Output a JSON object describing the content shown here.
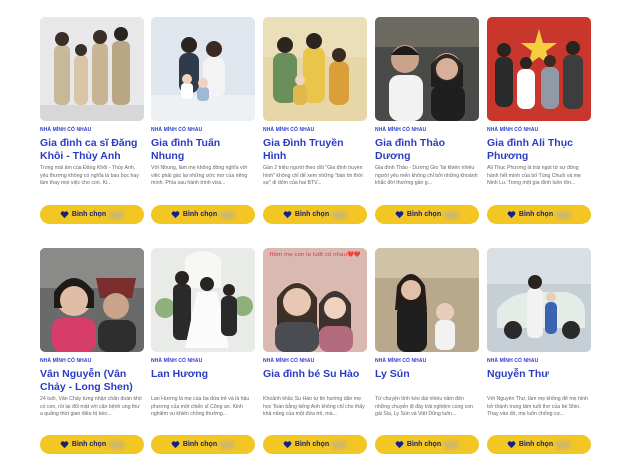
{
  "cards": [
    {
      "tag": "nhà mình có nhau",
      "name": "Gia đình ca sĩ Đăng Khôi - Thủy Anh",
      "desc": "Trong mái ấm của Đăng Khôi - Thủy Anh, yêu thương không có nghĩa là bao bọc hay làm thay mọi việc cho con. Ki...",
      "vote": "Bình chọn",
      "bg": "#e8e8ea"
    },
    {
      "tag": "nhà mình có nhau",
      "name": "Gia đình Tuấn Nhung",
      "desc": "Với Nhung, làm mẹ không đồng nghĩa với việc phải gác lại những ước mơ của riêng mình. Phía sau hành trình vừa...",
      "vote": "Bình chọn",
      "bg": "#dfe6ee"
    },
    {
      "tag": "nhà mình có nhau",
      "name": "Gia Đình Truyền Hình",
      "desc": "Gần 2 triệu người theo dõi \"Gia đình truyền hình\" không chỉ để xem những \"bàn tin thời sự\" di dỏm của hai BTV...",
      "vote": "Bình chọn",
      "bg": "#e7d7a8"
    },
    {
      "tag": "nhà mình có nhau",
      "name": "Gia đình Thảo Dương",
      "desc": "Gia đình Thảo - Dương Gio Tai khiến nhiều người yêu mến không chỉ bởi những khoảnh khắc đời thường gần g...",
      "vote": "Bình chọn",
      "bg": "#4a4a48"
    },
    {
      "tag": "nhà mình có nhau",
      "name": "Gia đình Ali Thục Phương",
      "desc": "Ali Thục Phương là trái ngọt từ sự đồng hành hết mình của bố Tùng Chuối và mẹ Ninh Lu. Trong một gia đình luôn tôn...",
      "vote": "Bình chọn",
      "bg": "#c9372c"
    },
    {
      "tag": "nhà mình có nhau",
      "name": "Vân Nguyễn (Vân Chảy - Long Shen)",
      "desc": "24 tuổi, Vân Chảy từng nhận chẩn đoán khó có con, rồi lại đối mặt với căn bệnh ung thư a quãng thời gian điều trị kéo...",
      "vote": "Bình chọn",
      "bg": "#6a6a6a"
    },
    {
      "tag": "nhà mình có nhau",
      "name": "Lan Hương",
      "desc": "Lan Hương là mẹ của ba đứa trẻ và là hậu phương của một chiến sĩ Công an. Kinh nghiệm vụ khiến chồng thường...",
      "vote": "Bình chọn",
      "bg": "#e9ebe8"
    },
    {
      "tag": "nhà mình có nhau",
      "name": "Gia đình bé Su Hào",
      "desc": "Khoảnh khắc Su Hào tự tin hướng dẫn mẹ học Toán bằng tiếng Anh không chỉ cho thấy khả năng của một đứa trẻ, mà...",
      "vote": "Bình chọn",
      "bg": "#d9b9b0",
      "overlay": "Hôm mẹ con lo lướt có nhau❤️❤️"
    },
    {
      "tag": "nhà mình có nhau",
      "name": "Ly Sún",
      "desc": "Từ chuyện tình kéo dài nhiều năm đến những chuyến đi đầy trải nghiệm cùng con gái Sia, Ly Sún và Việt Dũng luôn...",
      "vote": "Bình chọn",
      "bg": "#b9a98c"
    },
    {
      "tag": "nhà mình có nhau",
      "name": "Nguyễn Thư",
      "desc": "Với Nguyễn Thư, làm mẹ không để mẹ hình trở thành trung tâm tuổi thơ của bé Shin. Thay vào đó, mẹ luôn chống cư...",
      "vote": "Bình chọn",
      "bg": "#c7cfd6"
    }
  ],
  "colors": {
    "accent": "#2b3cc4",
    "button": "#f2c623",
    "button_text": "#17207a"
  },
  "icons": {
    "vote": "heart-icon"
  }
}
